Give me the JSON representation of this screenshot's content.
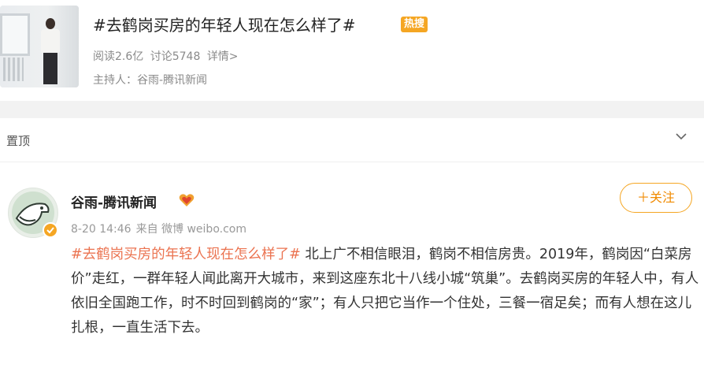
{
  "topic": {
    "title": "#去鹤岗买房的年轻人现在怎么样了#",
    "badge": "热搜",
    "reads": "阅读2.6亿",
    "discussions": "讨论5748",
    "details_link": "详情>",
    "host_label": "主持人：",
    "host_name": "谷雨-腾讯新闻"
  },
  "pinned": {
    "label": "置顶",
    "expand_icon": "chevron-down-icon"
  },
  "post": {
    "author": "谷雨-腾讯新闻",
    "author_badge_icon": "heart-badge-icon",
    "timestamp": "8-20 14:46",
    "source": "来自 微博 weibo.com",
    "follow_label": "＋关注",
    "hashtag": "#去鹤岗买房的年轻人现在怎么样了#",
    "body": " 北上广不相信眼泪，鹤岗不相信房贵。2019年，鹤岗因“白菜房价”走红，一群年轻人闻此离开大城市，来到这座东北十八线小城“筑巢”。去鹤岗买房的年轻人中，有人依旧全国跑工作，时不时回到鹤岗的“家”；有人只把它当作一个住处，三餐一宿足矣；而有人想在这儿扎根，一直生活下去。"
  },
  "colors": {
    "accent": "#f08a00",
    "hashtag": "#eb7350",
    "badge": "#f5a623"
  }
}
